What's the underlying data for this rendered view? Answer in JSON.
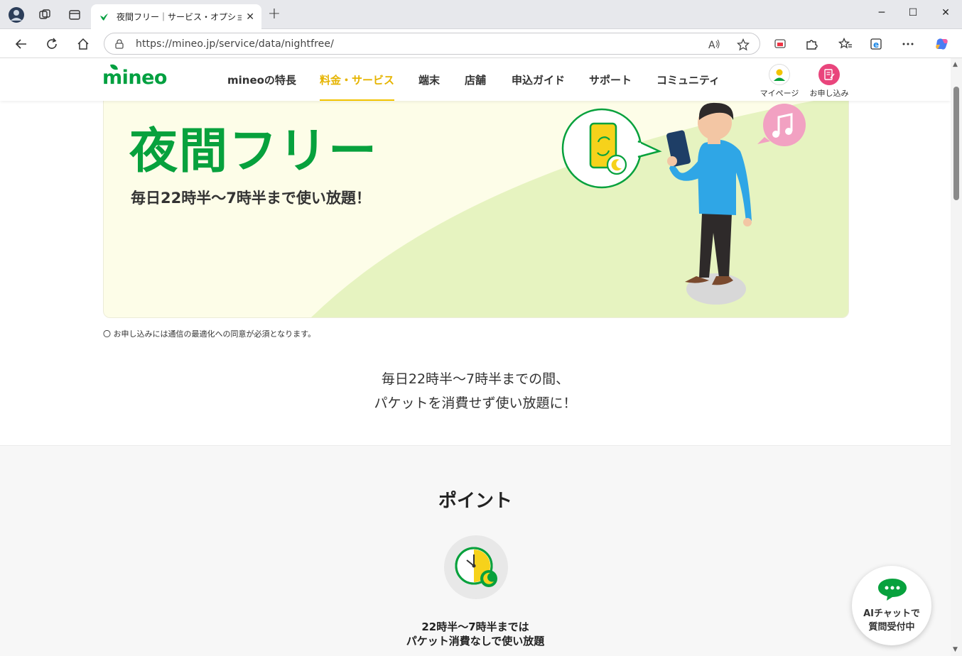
{
  "browser": {
    "tab_title": "夜間フリー｜サービス・オプション｜格安",
    "url": "https://mineo.jp/service/data/nightfree/"
  },
  "site": {
    "logo": "mineo",
    "nav": [
      {
        "label": "mineoの特長",
        "active": false
      },
      {
        "label": "料金・サービス",
        "active": true
      },
      {
        "label": "端末",
        "active": false
      },
      {
        "label": "店舗",
        "active": false
      },
      {
        "label": "申込ガイド",
        "active": false
      },
      {
        "label": "サポート",
        "active": false
      },
      {
        "label": "コミュニティ",
        "active": false
      }
    ],
    "mypage_label": "マイページ",
    "apply_label": "お申し込み"
  },
  "hero": {
    "title": "夜間フリー",
    "subtitle": "毎日22時半〜7時半まで使い放題！"
  },
  "note": "〇 お申し込みには通信の最適化への同意が必須となります。",
  "lead": {
    "line1": "毎日22時半〜7時半までの間、",
    "line2": "パケットを消費せず使い放題に！"
  },
  "points": {
    "title": "ポイント",
    "item1_line1": "22時半〜7時半までは",
    "item1_line2": "パケット消費なしで使い放題"
  },
  "ai_chat": {
    "line1": "AIチャットで",
    "line2": "質問受付中"
  },
  "colors": {
    "brand_green": "#07a13d",
    "accent_yellow": "#e6b400",
    "apply_pink": "#e9457c"
  }
}
